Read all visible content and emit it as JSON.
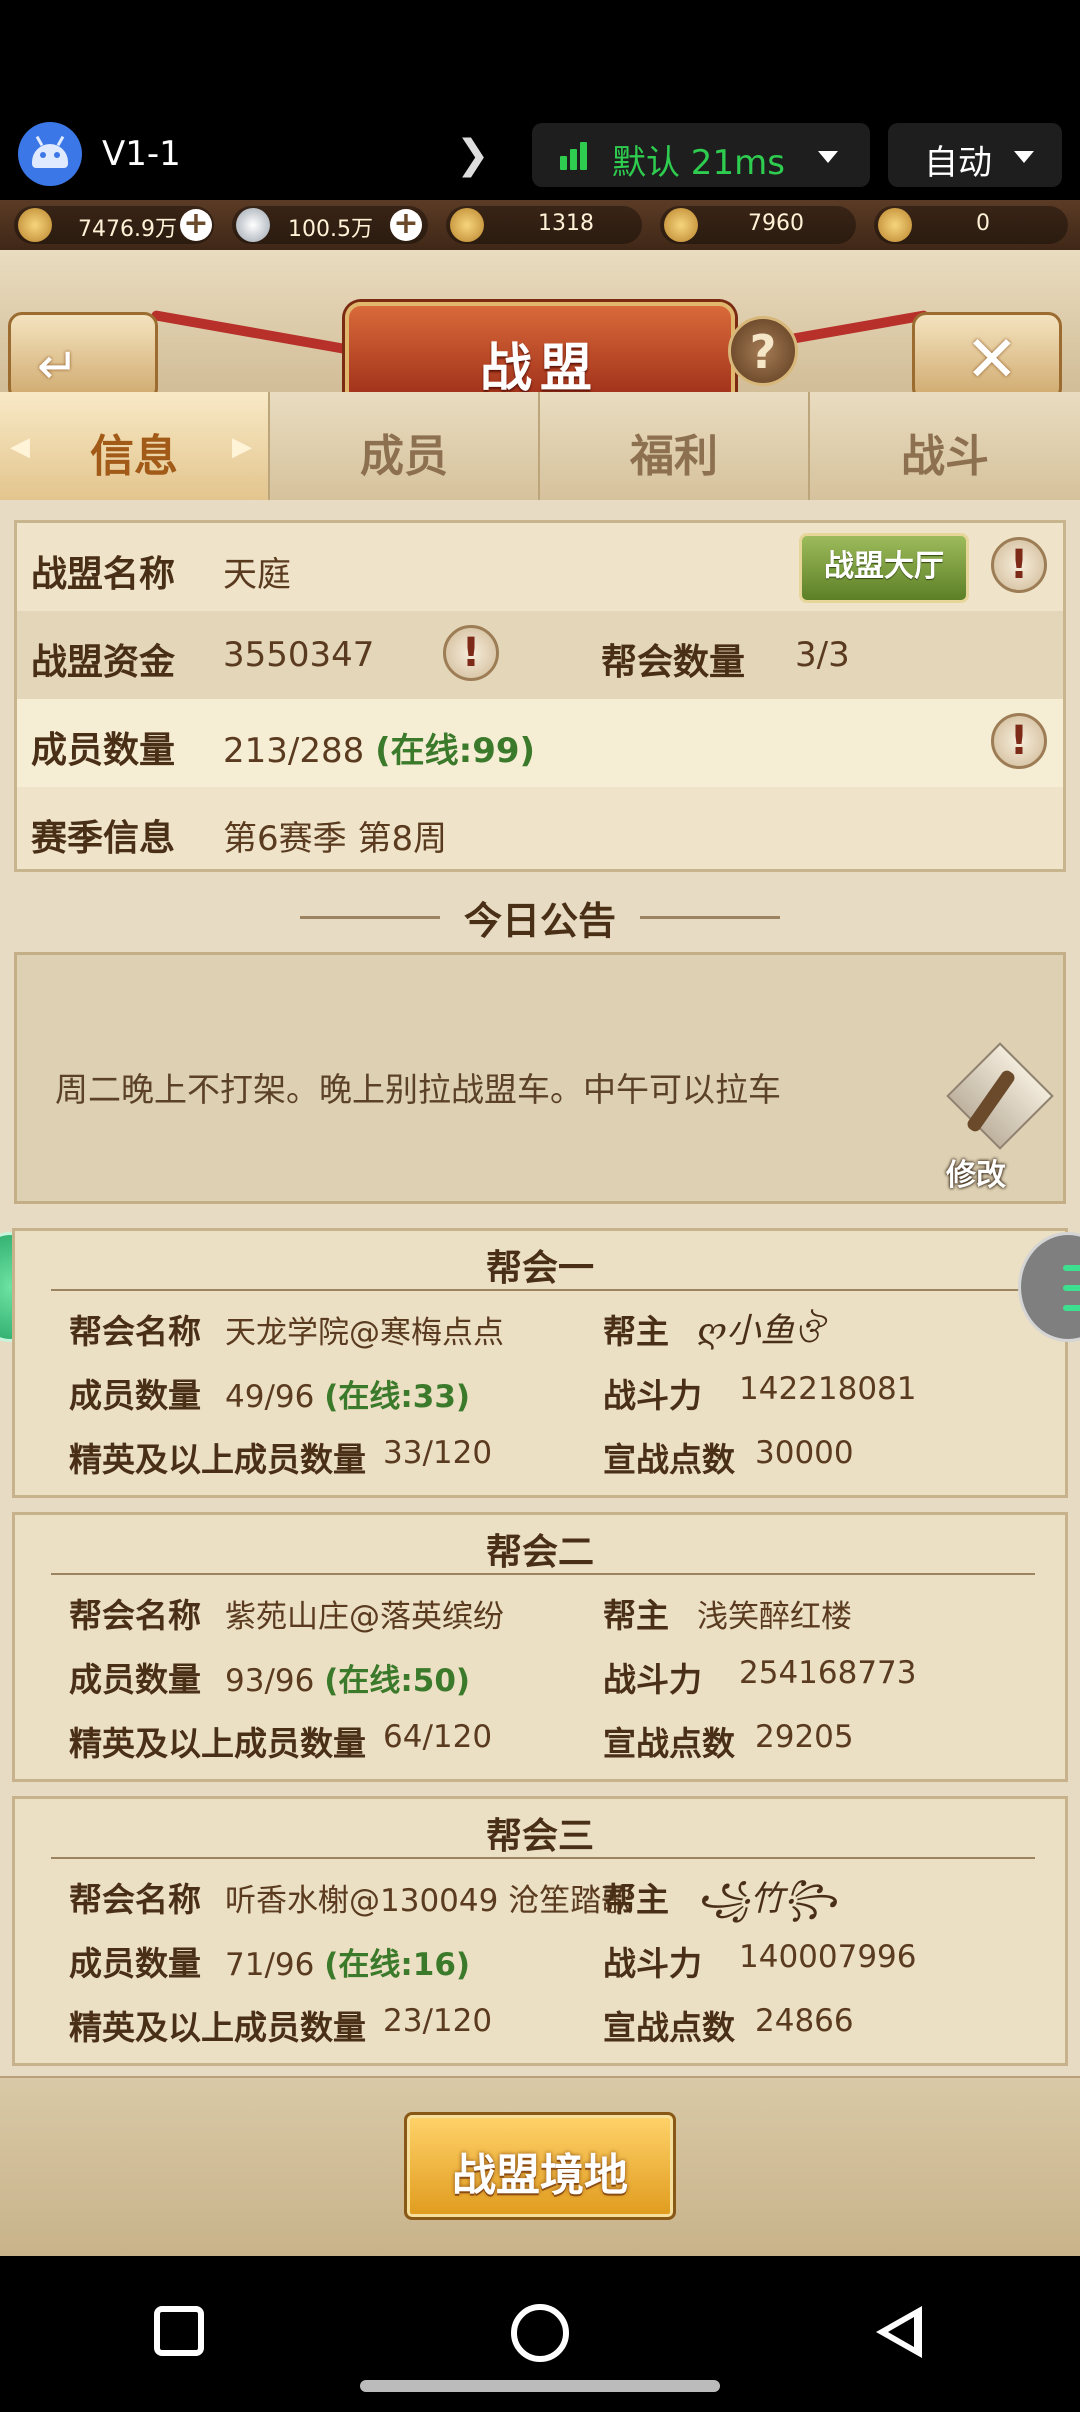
{
  "stream": {
    "name": "V1-1",
    "network": "默认 21ms",
    "quality": "自动"
  },
  "currency": [
    {
      "icon": "copper-coin-icon",
      "value": "7476.9万",
      "addable": true
    },
    {
      "icon": "silver-ingot-icon",
      "value": "100.5万",
      "addable": true
    },
    {
      "icon": "gold-ingot-icon",
      "value": "1318"
    },
    {
      "icon": "locked-gold-icon",
      "value": "7960"
    },
    {
      "icon": "gold-coin-icon",
      "value": "0"
    }
  ],
  "header": {
    "title": "战盟"
  },
  "tabs": [
    "信息",
    "成员",
    "福利",
    "战斗"
  ],
  "info": {
    "name_label": "战盟名称",
    "name": "天庭",
    "hall_button": "战盟大厅",
    "funds_label": "战盟资金",
    "funds": "3550347",
    "guild_count_label": "帮会数量",
    "guild_count": "3/3",
    "members_label": "成员数量",
    "members": "213/288",
    "members_online": "(在线:99)",
    "season_label": "赛季信息",
    "season": "第6赛季  第8周"
  },
  "notice": {
    "title": "今日公告",
    "text": "周二晚上不打架。晚上别拉战盟车。中午可以拉车",
    "edit_label": "修改"
  },
  "guild_labels": {
    "name": "帮会名称",
    "members": "成员数量",
    "elite": "精英及以上成员数量",
    "leader": "帮主",
    "power": "战斗力",
    "war_points": "宣战点数"
  },
  "guilds": [
    {
      "title": "帮会一",
      "name": "天龙学院@寒梅点点",
      "leader": "ღ小鱼ঔ",
      "members": "49/96",
      "online": "(在线:33)",
      "elite": "33/120",
      "power": "142218081",
      "war_points": "30000"
    },
    {
      "title": "帮会二",
      "name": "紫苑山庄@落英缤纷",
      "leader": "浅笑醉红楼",
      "members": "93/96",
      "online": "(在线:50)",
      "elite": "64/120",
      "power": "254168773",
      "war_points": "29205"
    },
    {
      "title": "帮会三",
      "name": "听香水榭@130049 沧笙踏歌",
      "leader": "꧁竹꧂",
      "members": "71/96",
      "online": "(在线:16)",
      "elite": "23/120",
      "power": "140007996",
      "war_points": "24866"
    }
  ],
  "realm_button": "战盟境地"
}
